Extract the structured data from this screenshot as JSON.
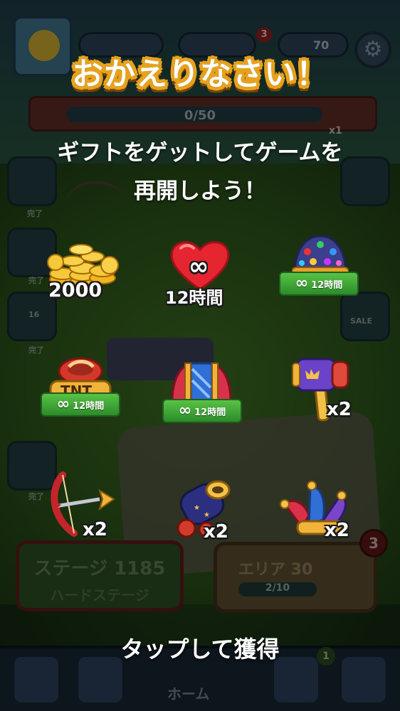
{
  "hud": {
    "stars": "70",
    "notification_count": "3",
    "progress_text": "0/50",
    "tnt_multiplier": "x1"
  },
  "background": {
    "side_labels": [
      "完了",
      "完了",
      "完了",
      "完了"
    ],
    "side_level": "16",
    "sale_label": "SALE",
    "stage_title": "ステージ 1185",
    "stage_subtitle": "ハードステージ",
    "area_title": "エリア 30",
    "area_progress": "2/10",
    "area_badge": "3",
    "nav_home": "ホーム",
    "nav_badge": "1"
  },
  "popup": {
    "title": "おかえりなさい！",
    "subtitle_line1": "ギフトをゲットしてゲームを",
    "subtitle_line2": "再開しよう！",
    "tap_text": "タップして獲得"
  },
  "rewards": [
    {
      "name": "coins",
      "qty": "2000"
    },
    {
      "name": "infinite-hearts",
      "infinity": "∞",
      "qty": "12時間"
    },
    {
      "name": "disco-ball-booster",
      "infinity": "∞",
      "qty": "12時間"
    },
    {
      "name": "tnt-booster",
      "label": "TNT",
      "infinity": "∞",
      "qty": "12時間"
    },
    {
      "name": "rocket-booster",
      "infinity": "∞",
      "qty": "12時間"
    },
    {
      "name": "hammer",
      "qty": "x2"
    },
    {
      "name": "arrow",
      "qty": "x2"
    },
    {
      "name": "cannon",
      "qty": "x2"
    },
    {
      "name": "jester-hat",
      "qty": "x2"
    }
  ]
}
